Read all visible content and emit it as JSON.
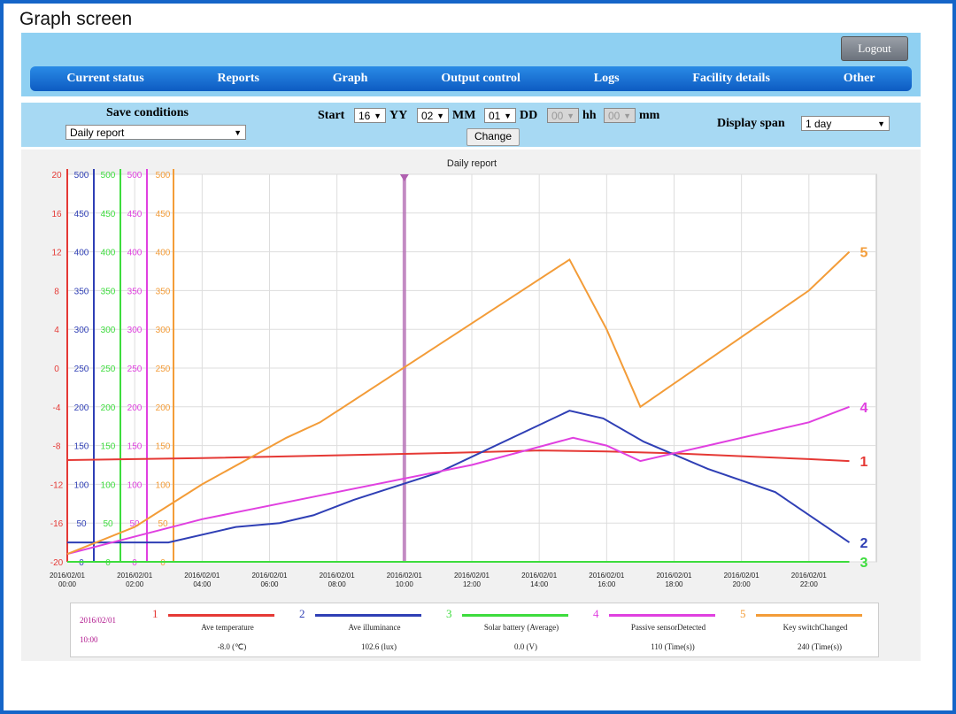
{
  "page_title": "Graph screen",
  "header": {
    "logout_label": "Logout",
    "menu": [
      "Current status",
      "Reports",
      "Graph",
      "Output control",
      "Logs",
      "Facility details",
      "Other"
    ]
  },
  "conditions": {
    "save_label": "Save conditions",
    "save_value": "Daily report",
    "start_label": "Start",
    "yy_value": "16",
    "yy_label": "YY",
    "mm_value": "02",
    "mm_label": "MM",
    "dd_value": "01",
    "dd_label": "DD",
    "hh_value": "00",
    "hh_label": "hh",
    "min_value": "00",
    "min_label": "mm",
    "change_label": "Change",
    "span_label": "Display span",
    "span_value": "1 day"
  },
  "colors": {
    "s1": "#e53935",
    "s2": "#2f3fb5",
    "s3": "#3ddc3d",
    "s4": "#e040e0",
    "s5": "#f39c38",
    "cursor": "#b060b0"
  },
  "chart_data": {
    "type": "line",
    "title": "Daily report",
    "x_tick_labels": [
      [
        "2016/02/01",
        "00:00"
      ],
      [
        "2016/02/01",
        "02:00"
      ],
      [
        "2016/02/01",
        "04:00"
      ],
      [
        "2016/02/01",
        "06:00"
      ],
      [
        "2016/02/01",
        "08:00"
      ],
      [
        "2016/02/01",
        "10:00"
      ],
      [
        "2016/02/01",
        "12:00"
      ],
      [
        "2016/02/01",
        "14:00"
      ],
      [
        "2016/02/01",
        "16:00"
      ],
      [
        "2016/02/01",
        "18:00"
      ],
      [
        "2016/02/01",
        "20:00"
      ],
      [
        "2016/02/01",
        "22:00"
      ]
    ],
    "xlim": [
      0,
      24
    ],
    "cursor_hour": 10,
    "axes": [
      {
        "id": "1",
        "ticks": [
          "20",
          "16",
          "12",
          "8",
          "4",
          "0",
          "-4",
          "-8",
          "-12",
          "-16",
          "-20"
        ],
        "min": -20,
        "max": 20
      },
      {
        "id": "2",
        "ticks": [
          "500",
          "450",
          "400",
          "350",
          "300",
          "250",
          "200",
          "150",
          "100",
          "50",
          "0"
        ],
        "min": 0,
        "max": 500
      },
      {
        "id": "3",
        "ticks": [
          "500",
          "450",
          "400",
          "350",
          "300",
          "250",
          "200",
          "150",
          "100",
          "50",
          "0"
        ],
        "min": 0,
        "max": 500
      },
      {
        "id": "4",
        "ticks": [
          "500",
          "450",
          "400",
          "350",
          "300",
          "250",
          "200",
          "150",
          "100",
          "50",
          "0"
        ],
        "min": 0,
        "max": 500
      },
      {
        "id": "5",
        "ticks": [
          "500",
          "450",
          "400",
          "350",
          "300",
          "250",
          "200",
          "150",
          "100",
          "50",
          "0"
        ],
        "min": 0,
        "max": 500
      }
    ],
    "series": [
      {
        "id": "1",
        "label": "1",
        "axis": 0,
        "points": [
          [
            0,
            -9.5
          ],
          [
            4,
            -9.3
          ],
          [
            8,
            -9
          ],
          [
            12,
            -8.7
          ],
          [
            14,
            -8.5
          ],
          [
            16,
            -8.6
          ],
          [
            18,
            -8.8
          ],
          [
            20,
            -9.1
          ],
          [
            22,
            -9.4
          ],
          [
            23.2,
            -9.6
          ]
        ]
      },
      {
        "id": "2",
        "label": "2",
        "axis": 1,
        "points": [
          [
            0,
            25
          ],
          [
            3,
            25
          ],
          [
            5,
            45
          ],
          [
            6.3,
            50
          ],
          [
            7.3,
            60
          ],
          [
            8.5,
            80
          ],
          [
            11,
            115
          ],
          [
            14.9,
            195
          ],
          [
            15.9,
            185
          ],
          [
            17.1,
            155
          ],
          [
            19,
            120
          ],
          [
            21,
            90
          ],
          [
            23.2,
            25
          ]
        ]
      },
      {
        "id": "3",
        "label": "3",
        "axis": 2,
        "points": [
          [
            0,
            0
          ],
          [
            23.2,
            0
          ]
        ]
      },
      {
        "id": "4",
        "label": "4",
        "axis": 3,
        "points": [
          [
            0,
            10
          ],
          [
            4,
            55
          ],
          [
            8,
            90
          ],
          [
            12,
            125
          ],
          [
            15,
            160
          ],
          [
            16,
            150
          ],
          [
            17,
            130
          ],
          [
            19,
            150
          ],
          [
            22,
            180
          ],
          [
            23.2,
            200
          ]
        ]
      },
      {
        "id": "5",
        "label": "5",
        "axis": 4,
        "points": [
          [
            0,
            10
          ],
          [
            2,
            45
          ],
          [
            4,
            100
          ],
          [
            6.5,
            160
          ],
          [
            7.5,
            180
          ],
          [
            14.9,
            390
          ],
          [
            16,
            300
          ],
          [
            17,
            200
          ],
          [
            19,
            260
          ],
          [
            22,
            350
          ],
          [
            23.2,
            400
          ]
        ]
      }
    ]
  },
  "legend": {
    "date": "2016/02/01",
    "time": "10:00",
    "items": [
      {
        "num": "1",
        "name": "Ave temperature",
        "value": "-8.0 (℃)"
      },
      {
        "num": "2",
        "name": "Ave illuminance",
        "value": "102.6 (lux)"
      },
      {
        "num": "3",
        "name": "Solar battery (Average)",
        "value": "0.0 (V)"
      },
      {
        "num": "4",
        "name": "Passive sensorDetected",
        "value": "110 (Time(s))"
      },
      {
        "num": "5",
        "name": "Key switchChanged",
        "value": "240 (Time(s))"
      }
    ]
  }
}
